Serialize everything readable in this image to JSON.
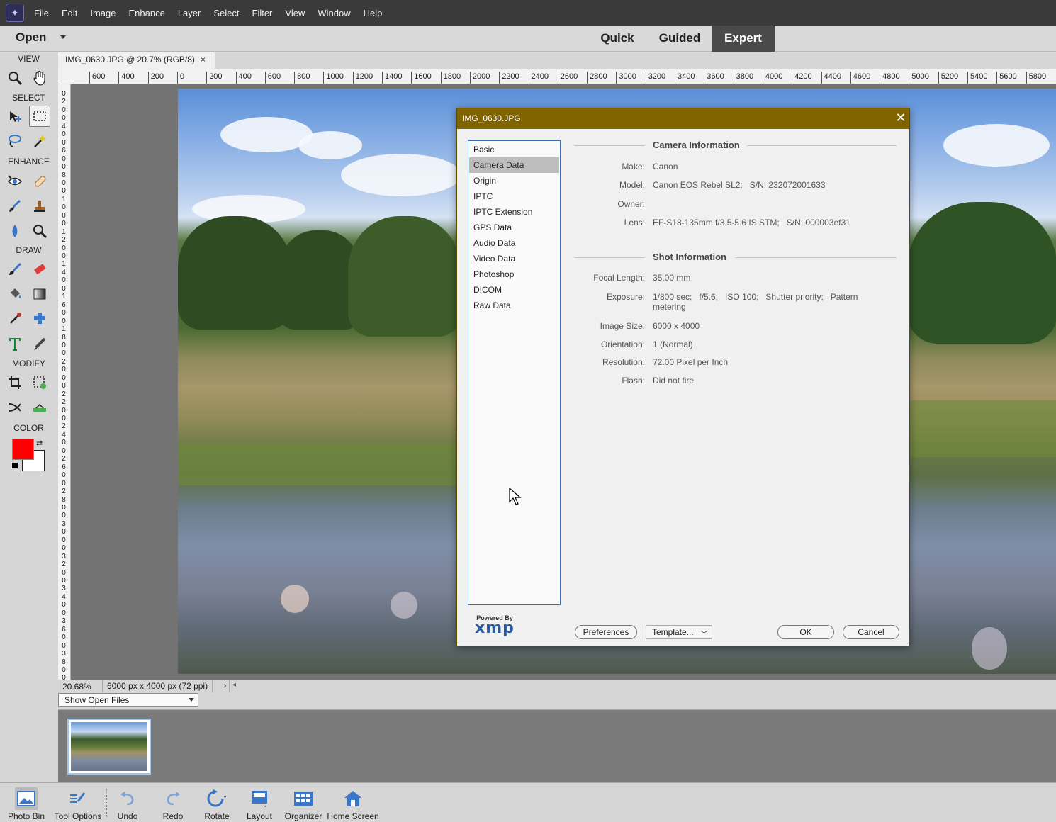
{
  "menubar": {
    "items": [
      "File",
      "Edit",
      "Image",
      "Enhance",
      "Layer",
      "Select",
      "Filter",
      "View",
      "Window",
      "Help"
    ]
  },
  "modebar": {
    "open_label": "Open",
    "tabs": [
      "Quick",
      "Guided",
      "Expert"
    ],
    "active_tab": "Expert"
  },
  "toolbox": {
    "sections": [
      "VIEW",
      "SELECT",
      "ENHANCE",
      "DRAW",
      "MODIFY",
      "COLOR"
    ],
    "foreground_color": "#ff0000",
    "background_color": "#ffffff"
  },
  "document": {
    "tab_title": "IMG_0630.JPG @ 20.7% (RGB/8)",
    "close_symbol": "×",
    "ruler_h_labels": [
      "600",
      "400",
      "200",
      "0",
      "200",
      "400",
      "600",
      "800",
      "1000",
      "1200",
      "1400",
      "1600",
      "1800",
      "2000",
      "2200",
      "2400",
      "2600",
      "2800",
      "3000",
      "3200",
      "3400",
      "3600",
      "3800",
      "4000",
      "4200",
      "4400",
      "4600",
      "4800",
      "5000",
      "5200",
      "5400",
      "5600",
      "5800"
    ],
    "ruler_v_labels": [
      "0",
      "2",
      "0",
      "0",
      "4",
      "0",
      "0",
      "6",
      "0",
      "0",
      "8",
      "0",
      "0",
      "1",
      "0",
      "0",
      "0",
      "1",
      "2",
      "0",
      "0",
      "1",
      "4",
      "0",
      "0",
      "1",
      "6",
      "0",
      "0",
      "1",
      "8",
      "0",
      "0",
      "2",
      "0",
      "0",
      "0",
      "2",
      "2",
      "0",
      "0",
      "2",
      "4",
      "0",
      "0",
      "2",
      "6",
      "0",
      "0",
      "2",
      "8",
      "0",
      "0",
      "3",
      "0",
      "0",
      "0",
      "3",
      "2",
      "0",
      "0",
      "3",
      "4",
      "0",
      "0",
      "3",
      "6",
      "0",
      "0",
      "3",
      "8",
      "0",
      "0"
    ]
  },
  "status": {
    "zoom": "20.68%",
    "dimensions": "6000 px x 4000 px (72 ppi)",
    "next_symbol": "›",
    "scroll_left_symbol": "◂"
  },
  "photobin": {
    "dropdown_value": "Show Open Files"
  },
  "taskbar": {
    "buttons": [
      "Photo Bin",
      "Tool Options",
      "Undo",
      "Redo",
      "Rotate",
      "Layout",
      "Organizer",
      "Home Screen"
    ]
  },
  "dialog": {
    "title": "IMG_0630.JPG",
    "close_symbol": "✕",
    "categories": [
      "Basic",
      "Camera Data",
      "Origin",
      "IPTC",
      "IPTC Extension",
      "GPS Data",
      "Audio Data",
      "Video Data",
      "Photoshop",
      "DICOM",
      "Raw Data"
    ],
    "selected_category": "Camera Data",
    "camera_section_title": "Camera Information",
    "camera_fields": [
      {
        "label": "Make:",
        "value": "Canon"
      },
      {
        "label": "Model:",
        "value": "Canon EOS Rebel SL2;   S/N: 232072001633"
      },
      {
        "label": "Owner:",
        "value": ""
      },
      {
        "label": "Lens:",
        "value": "EF-S18-135mm f/3.5-5.6 IS STM;   S/N: 000003ef31"
      }
    ],
    "shot_section_title": "Shot Information",
    "shot_fields": [
      {
        "label": "Focal Length:",
        "value": "35.00 mm"
      },
      {
        "label": "Exposure:",
        "value": "1/800 sec;   f/5.6;   ISO 100;   Shutter priority;   Pattern metering"
      },
      {
        "label": "Image Size:",
        "value": "6000 x 4000"
      },
      {
        "label": "Orientation:",
        "value": "1 (Normal)"
      },
      {
        "label": "Resolution:",
        "value": "72.00 Pixel per Inch"
      },
      {
        "label": "Flash:",
        "value": "Did not fire"
      }
    ],
    "xmp_powered": "Powered By",
    "xmp_logo": "xmp",
    "buttons": {
      "preferences": "Preferences",
      "template": "Template...",
      "ok": "OK",
      "cancel": "Cancel"
    },
    "title_bar_color": "#806400"
  }
}
